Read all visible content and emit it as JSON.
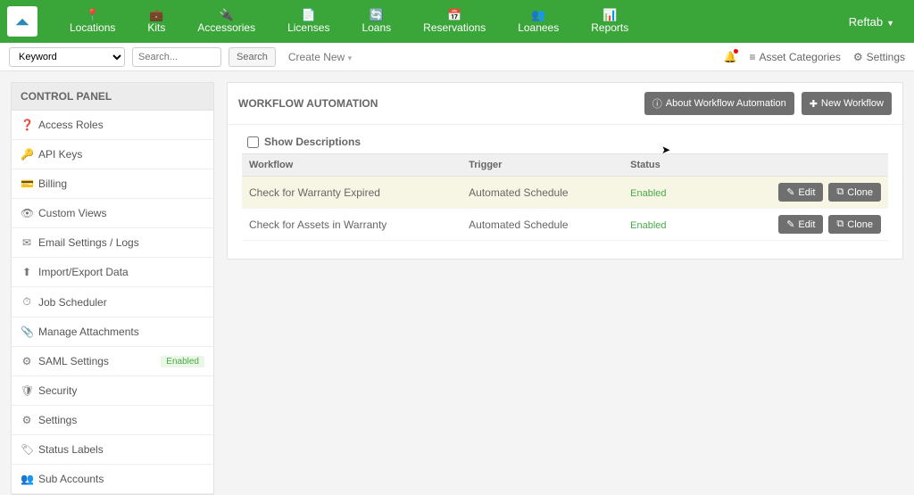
{
  "brand": "Reftab",
  "topnav": [
    {
      "label": "Locations",
      "icon": "📍"
    },
    {
      "label": "Kits",
      "icon": "💼"
    },
    {
      "label": "Accessories",
      "icon": "🔌"
    },
    {
      "label": "Licenses",
      "icon": "📄"
    },
    {
      "label": "Loans",
      "icon": "🔄"
    },
    {
      "label": "Reservations",
      "icon": "📅"
    },
    {
      "label": "Loanees",
      "icon": "👥"
    },
    {
      "label": "Reports",
      "icon": "📊"
    }
  ],
  "toolbar": {
    "keyword": "Keyword",
    "search_placeholder": "Search...",
    "search_btn": "Search",
    "create_new": "Create New",
    "asset_categories": "Asset Categories",
    "settings": "Settings"
  },
  "sidebar": {
    "title": "CONTROL PANEL",
    "items": [
      {
        "label": "Access Roles",
        "icon": "❓"
      },
      {
        "label": "API Keys",
        "icon": "🔑"
      },
      {
        "label": "Billing",
        "icon": "💳"
      },
      {
        "label": "Custom Views",
        "icon": "👁"
      },
      {
        "label": "Email Settings / Logs",
        "icon": "✉"
      },
      {
        "label": "Import/Export Data",
        "icon": "⬆"
      },
      {
        "label": "Job Scheduler",
        "icon": "⏱"
      },
      {
        "label": "Manage Attachments",
        "icon": "📎"
      },
      {
        "label": "SAML Settings",
        "icon": "⚙",
        "badge": "Enabled"
      },
      {
        "label": "Security",
        "icon": "🛡"
      },
      {
        "label": "Settings",
        "icon": "⚙"
      },
      {
        "label": "Status Labels",
        "icon": "🏷"
      },
      {
        "label": "Sub Accounts",
        "icon": "👥"
      }
    ]
  },
  "page": {
    "title": "WORKFLOW AUTOMATION",
    "about_btn": "About Workflow Automation",
    "new_btn": "New Workflow",
    "show_desc": "Show Descriptions",
    "cols": {
      "workflow": "Workflow",
      "trigger": "Trigger",
      "status": "Status"
    },
    "rows": [
      {
        "workflow": "Check for Warranty Expired",
        "trigger": "Automated Schedule",
        "status": "Enabled"
      },
      {
        "workflow": "Check for Assets in Warranty",
        "trigger": "Automated Schedule",
        "status": "Enabled"
      }
    ],
    "edit": "Edit",
    "clone": "Clone"
  }
}
